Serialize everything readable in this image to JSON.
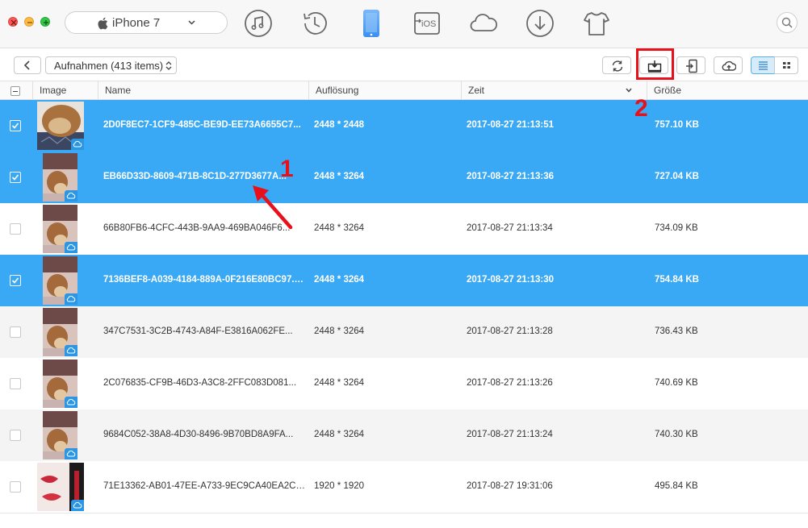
{
  "device": {
    "name": "iPhone 7"
  },
  "toolbar": {
    "icons": [
      "music-icon",
      "history-icon",
      "iphone-icon",
      "ios-transfer-icon",
      "icloud-icon",
      "download-icon",
      "tshirt-icon",
      "search-icon"
    ],
    "ios_label": "iOS",
    "active_color": "#3aa9f5"
  },
  "subbar": {
    "album_label": "Aufnahmen (413 items)"
  },
  "columns": {
    "image": "Image",
    "name": "Name",
    "resolution": "Auflösung",
    "time": "Zeit",
    "size": "Größe"
  },
  "annotations": {
    "one": "1",
    "two": "2",
    "color": "#e8101a"
  },
  "rows": [
    {
      "name": "2D0F8EC7-1CF9-485C-BE9D-EE73A6655C7...",
      "res": "2448 * 2448",
      "time": "2017-08-27 21:13:51",
      "size": "757.10 KB",
      "selected": true
    },
    {
      "name": "EB66D33D-8609-471B-8C1D-277D3677A...",
      "res": "2448 * 3264",
      "time": "2017-08-27 21:13:36",
      "size": "727.04 KB",
      "selected": true
    },
    {
      "name": "66B80FB6-4CFC-443B-9AA9-469BA046F6...",
      "res": "2448 * 3264",
      "time": "2017-08-27 21:13:34",
      "size": "734.09 KB",
      "selected": false
    },
    {
      "name": "7136BEF8-A039-4184-889A-0F216E80BC97.JPG",
      "res": "2448 * 3264",
      "time": "2017-08-27 21:13:30",
      "size": "754.84 KB",
      "selected": true
    },
    {
      "name": "347C7531-3C2B-4743-A84F-E3816A062FE...",
      "res": "2448 * 3264",
      "time": "2017-08-27 21:13:28",
      "size": "736.43 KB",
      "selected": false
    },
    {
      "name": "2C076835-CF9B-46D3-A3C8-2FFC083D081...",
      "res": "2448 * 3264",
      "time": "2017-08-27 21:13:26",
      "size": "740.69 KB",
      "selected": false
    },
    {
      "name": "9684C052-38A8-4D30-8496-9B70BD8A9FA...",
      "res": "2448 * 3264",
      "time": "2017-08-27 21:13:24",
      "size": "740.30 KB",
      "selected": false
    },
    {
      "name": "71E13362-AB01-47EE-A733-9EC9CA40EA2CB...",
      "res": "1920 * 1920",
      "time": "2017-08-27 19:31:06",
      "size": "495.84 KB",
      "selected": false
    }
  ]
}
